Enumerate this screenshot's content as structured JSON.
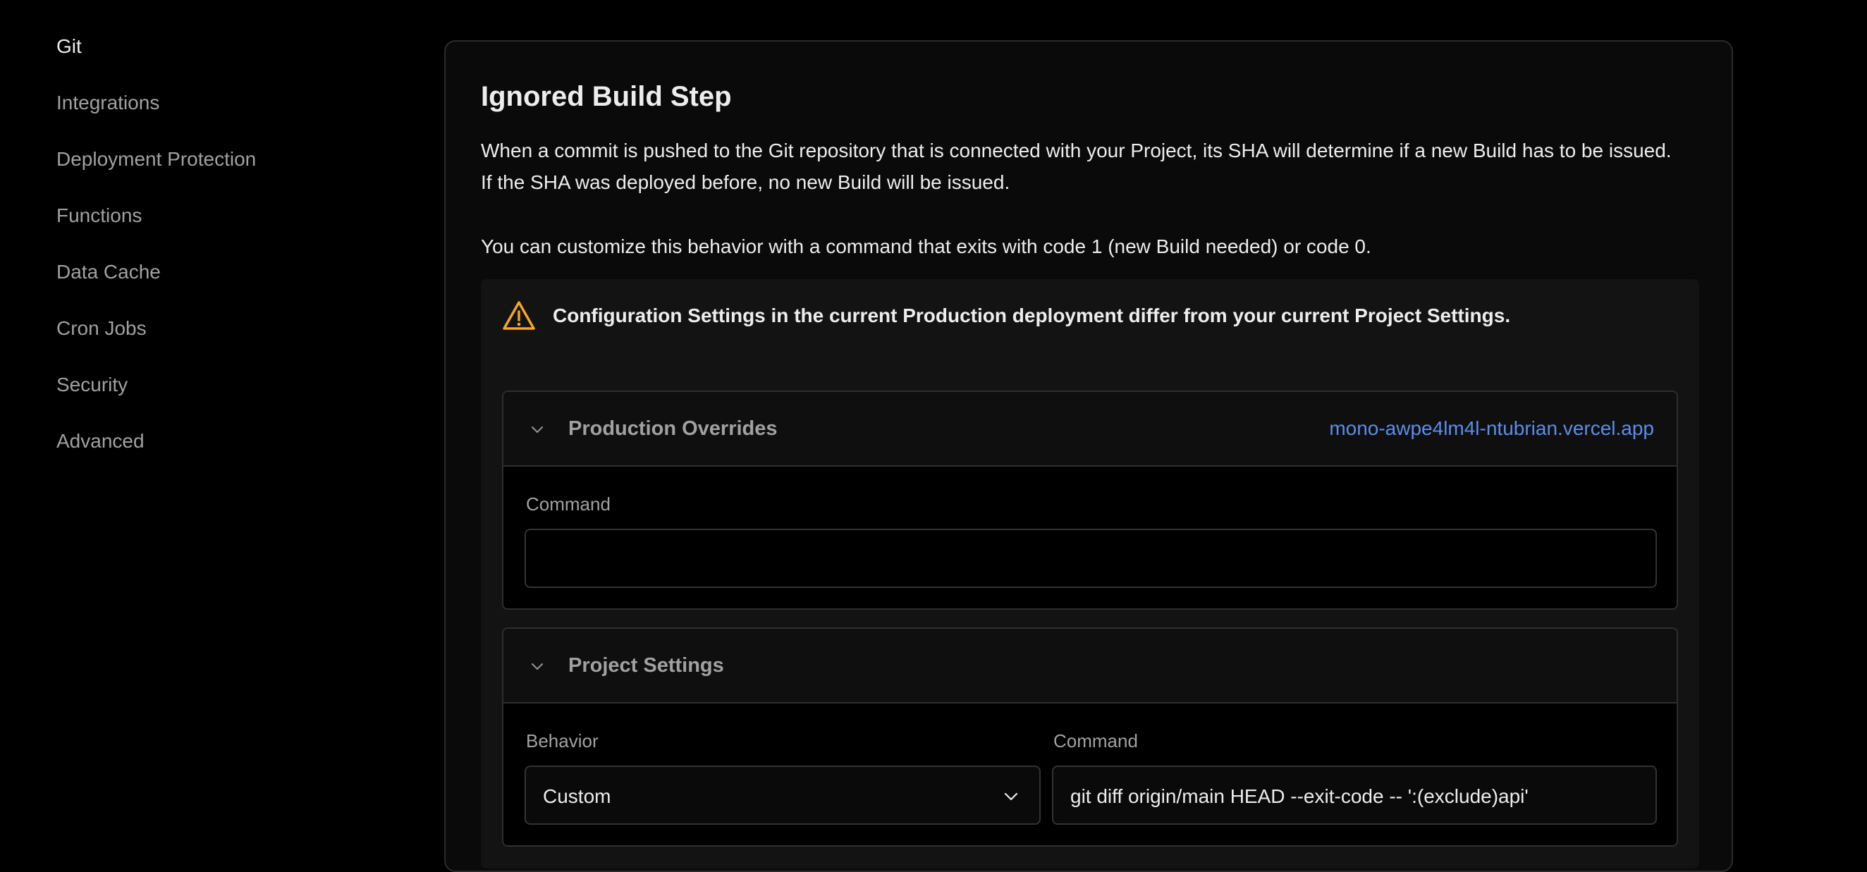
{
  "sidebar": {
    "items": [
      {
        "label": "Git",
        "active": true
      },
      {
        "label": "Integrations"
      },
      {
        "label": "Deployment Protection"
      },
      {
        "label": "Functions"
      },
      {
        "label": "Data Cache"
      },
      {
        "label": "Cron Jobs"
      },
      {
        "label": "Security"
      },
      {
        "label": "Advanced"
      }
    ]
  },
  "card": {
    "title": "Ignored Build Step",
    "description_1": "When a commit is pushed to the Git repository that is connected with your Project, its SHA will determine if a new Build has to be issued. If the SHA was deployed before, no new Build will be issued.",
    "description_2": "You can customize this behavior with a command that exits with code 1 (new Build needed) or code 0."
  },
  "warning": {
    "icon": "warning-triangle-icon",
    "text": "Configuration Settings in the current Production deployment differ from your current Project Settings."
  },
  "production_overrides": {
    "title": "Production Overrides",
    "deployment_link": "mono-awpe4lm4l-ntubrian.vercel.app",
    "command_label": "Command",
    "command_value": ""
  },
  "project_settings": {
    "title": "Project Settings",
    "behavior_label": "Behavior",
    "behavior_value": "Custom",
    "command_label": "Command",
    "command_value": "git diff origin/main HEAD --exit-code -- ':(exclude)api'"
  },
  "colors": {
    "background": "#000000",
    "card": "#0a0a0a",
    "link": "#5c8dea",
    "warning": "#f5a623",
    "muted_text": "#a1a1a1"
  }
}
